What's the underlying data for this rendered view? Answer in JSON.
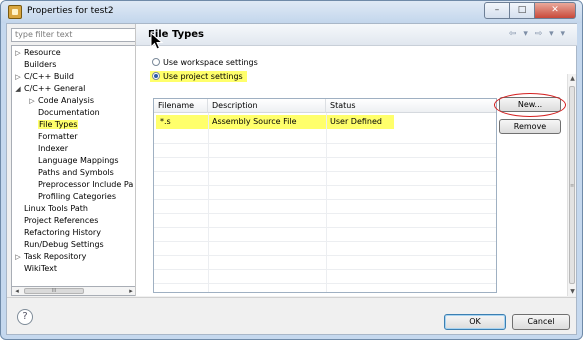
{
  "window": {
    "title": "Properties for test2",
    "buttons": {
      "minimize": "–",
      "maximize": "□",
      "close": "✕"
    }
  },
  "sidebar": {
    "filter_placeholder": "type filter text",
    "items": [
      {
        "label": "Resource",
        "expander": "▷"
      },
      {
        "label": "Builders",
        "expander": ""
      },
      {
        "label": "C/C++ Build",
        "expander": "▷"
      },
      {
        "label": "C/C++ General",
        "expander": "◢"
      },
      {
        "label": "Code Analysis",
        "expander": "▷"
      },
      {
        "label": "Documentation",
        "expander": ""
      },
      {
        "label": "File Types",
        "expander": "",
        "selected": true
      },
      {
        "label": "Formatter",
        "expander": ""
      },
      {
        "label": "Indexer",
        "expander": ""
      },
      {
        "label": "Language Mappings",
        "expander": ""
      },
      {
        "label": "Paths and Symbols",
        "expander": ""
      },
      {
        "label": "Preprocessor Include Pa",
        "expander": ""
      },
      {
        "label": "Profiling Categories",
        "expander": ""
      },
      {
        "label": "Linux Tools Path",
        "expander": ""
      },
      {
        "label": "Project References",
        "expander": ""
      },
      {
        "label": "Refactoring History",
        "expander": ""
      },
      {
        "label": "Run/Debug Settings",
        "expander": ""
      },
      {
        "label": "Task Repository",
        "expander": "▷"
      },
      {
        "label": "WikiText",
        "expander": ""
      }
    ],
    "hscroll": {
      "left": "◂",
      "right": "▸",
      "thumb": "III"
    }
  },
  "page": {
    "title": "File Types",
    "nav_icons": "⇦ ▾ ⇨ ▾ ▾",
    "options": {
      "workspace": "Use workspace settings",
      "project": "Use project settings"
    },
    "table": {
      "headers": [
        "Filename",
        "Description",
        "Status"
      ],
      "rows": [
        {
          "filename": "*.s",
          "description": "Assembly Source File",
          "status": "User Defined"
        }
      ]
    },
    "buttons": {
      "new": "New...",
      "remove": "Remove"
    },
    "vscroll": {
      "up": "▲",
      "down": "▼",
      "thumb": "≡"
    }
  },
  "footer": {
    "help": "?",
    "ok": "OK",
    "cancel": "Cancel"
  },
  "colors": {
    "highlight": "#ffff6b",
    "annotation": "#d42020",
    "chrome": "#c5d8ee"
  }
}
